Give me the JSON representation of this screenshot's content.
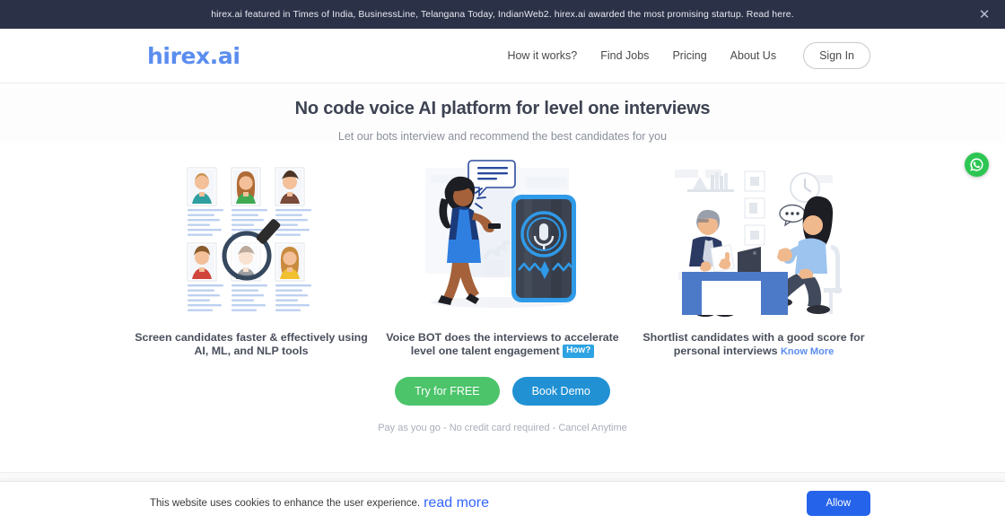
{
  "announcement": {
    "text": "hirex.ai featured in Times of India, BusinessLine, Telangana Today, IndianWeb2.  hirex.ai awarded the most promising startup. Read here.",
    "close_icon": "close-icon",
    "background_color": "#2b3147"
  },
  "header": {
    "logo": "hirex.ai",
    "logo_color": "#5b8def",
    "nav": [
      {
        "label": "How it works?"
      },
      {
        "label": "Find Jobs"
      },
      {
        "label": "Pricing"
      },
      {
        "label": "About Us"
      }
    ],
    "sign_in_label": "Sign In"
  },
  "hero": {
    "title": "No code voice AI platform for level one interviews",
    "subtitle": "Let our bots interview and recommend the best candidates for you"
  },
  "features": [
    {
      "art": "candidate-screening-illustration",
      "caption": "Screen candidates faster & effectively using AI, ML, and NLP tools",
      "badge": null,
      "link": null
    },
    {
      "art": "voice-bot-phone-illustration",
      "caption": "Voice BOT does the interviews to accelerate level one talent engagement",
      "badge": "How?",
      "badge_color": "#2ea3e3",
      "link": null
    },
    {
      "art": "interview-desk-illustration",
      "caption": "Shortlist candidates with a good score for personal interviews",
      "badge": null,
      "link": "Know More",
      "link_color": "#5b8def"
    }
  ],
  "cta": {
    "primary_label": "Try for FREE",
    "primary_color": "#4cc46a",
    "secondary_label": "Book Demo",
    "secondary_color": "#2191d4",
    "note": "Pay as you go - No credit card required - Cancel Anytime"
  },
  "floating": {
    "whatsapp_icon": "whatsapp-icon",
    "whatsapp_color": "#2dc653"
  },
  "cookies": {
    "message": "This website uses cookies to enhance the user experience.",
    "read_more_label": "read more",
    "allow_label": "Allow",
    "allow_color": "#2563eb"
  }
}
